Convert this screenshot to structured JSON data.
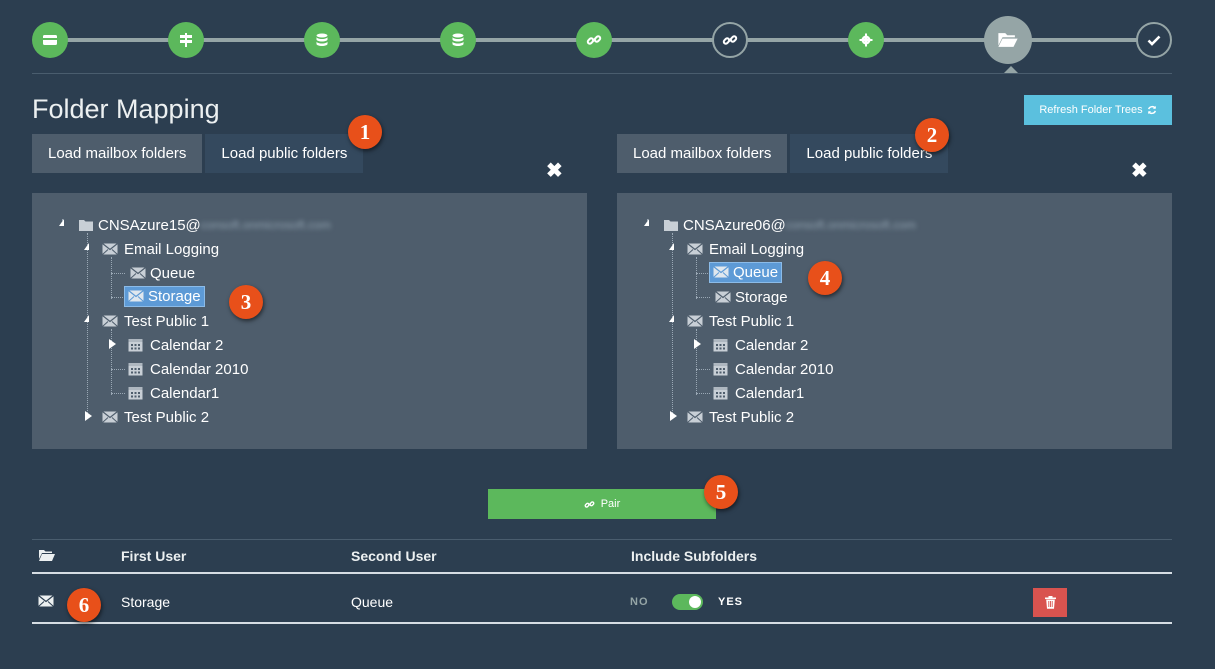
{
  "stepper": {
    "steps": [
      {
        "icon": "card-icon",
        "state": "done"
      },
      {
        "icon": "signpost-icon",
        "state": "done"
      },
      {
        "icon": "database-icon",
        "state": "done"
      },
      {
        "icon": "database-icon",
        "state": "done"
      },
      {
        "icon": "link-icon",
        "state": "done"
      },
      {
        "icon": "link-icon",
        "state": "outline"
      },
      {
        "icon": "gear-icon",
        "state": "done"
      },
      {
        "icon": "folder-open-icon",
        "state": "current"
      },
      {
        "icon": "check-icon",
        "state": "outline"
      }
    ]
  },
  "page": {
    "title": "Folder Mapping",
    "refresh_label": "Refresh Folder Trees"
  },
  "left": {
    "tab_mailbox": "Load mailbox folders",
    "tab_public": "Load public folders",
    "close": "✖",
    "tree": {
      "root": "CNSAzure15@",
      "root_blurred": "consoft.onmicrosoft.com",
      "email_logging": "Email Logging",
      "queue": "Queue",
      "storage": "Storage",
      "test_public_1": "Test Public 1",
      "calendar_2": "Calendar 2",
      "calendar_2010": "Calendar 2010",
      "calendar1": "Calendar1",
      "test_public_2": "Test Public 2"
    }
  },
  "right": {
    "tab_mailbox": "Load mailbox folders",
    "tab_public": "Load public folders",
    "close": "✖",
    "tree": {
      "root": "CNSAzure06@",
      "root_blurred": "consoft.onmicrosoft.com",
      "email_logging": "Email Logging",
      "queue": "Queue",
      "storage": "Storage",
      "test_public_1": "Test Public 1",
      "calendar_2": "Calendar 2",
      "calendar_2010": "Calendar 2010",
      "calendar1": "Calendar1",
      "test_public_2": "Test Public 2"
    }
  },
  "badges": [
    "1",
    "2",
    "3",
    "4",
    "5",
    "6"
  ],
  "pair": {
    "label": "Pair"
  },
  "table": {
    "headers": {
      "first_user": "First User",
      "second_user": "Second User",
      "include_subfolders": "Include Subfolders"
    },
    "rows": [
      {
        "first": "Storage",
        "second": "Queue",
        "no": "NO",
        "yes": "YES",
        "include_subfolders": true
      }
    ]
  },
  "colors": {
    "background": "#2c3e50",
    "panel": "#4e5d6c",
    "success": "#5cb85c",
    "info": "#5bc0de",
    "danger": "#d9534f",
    "badge": "#e8501a",
    "selected": "#5d9ad6"
  }
}
